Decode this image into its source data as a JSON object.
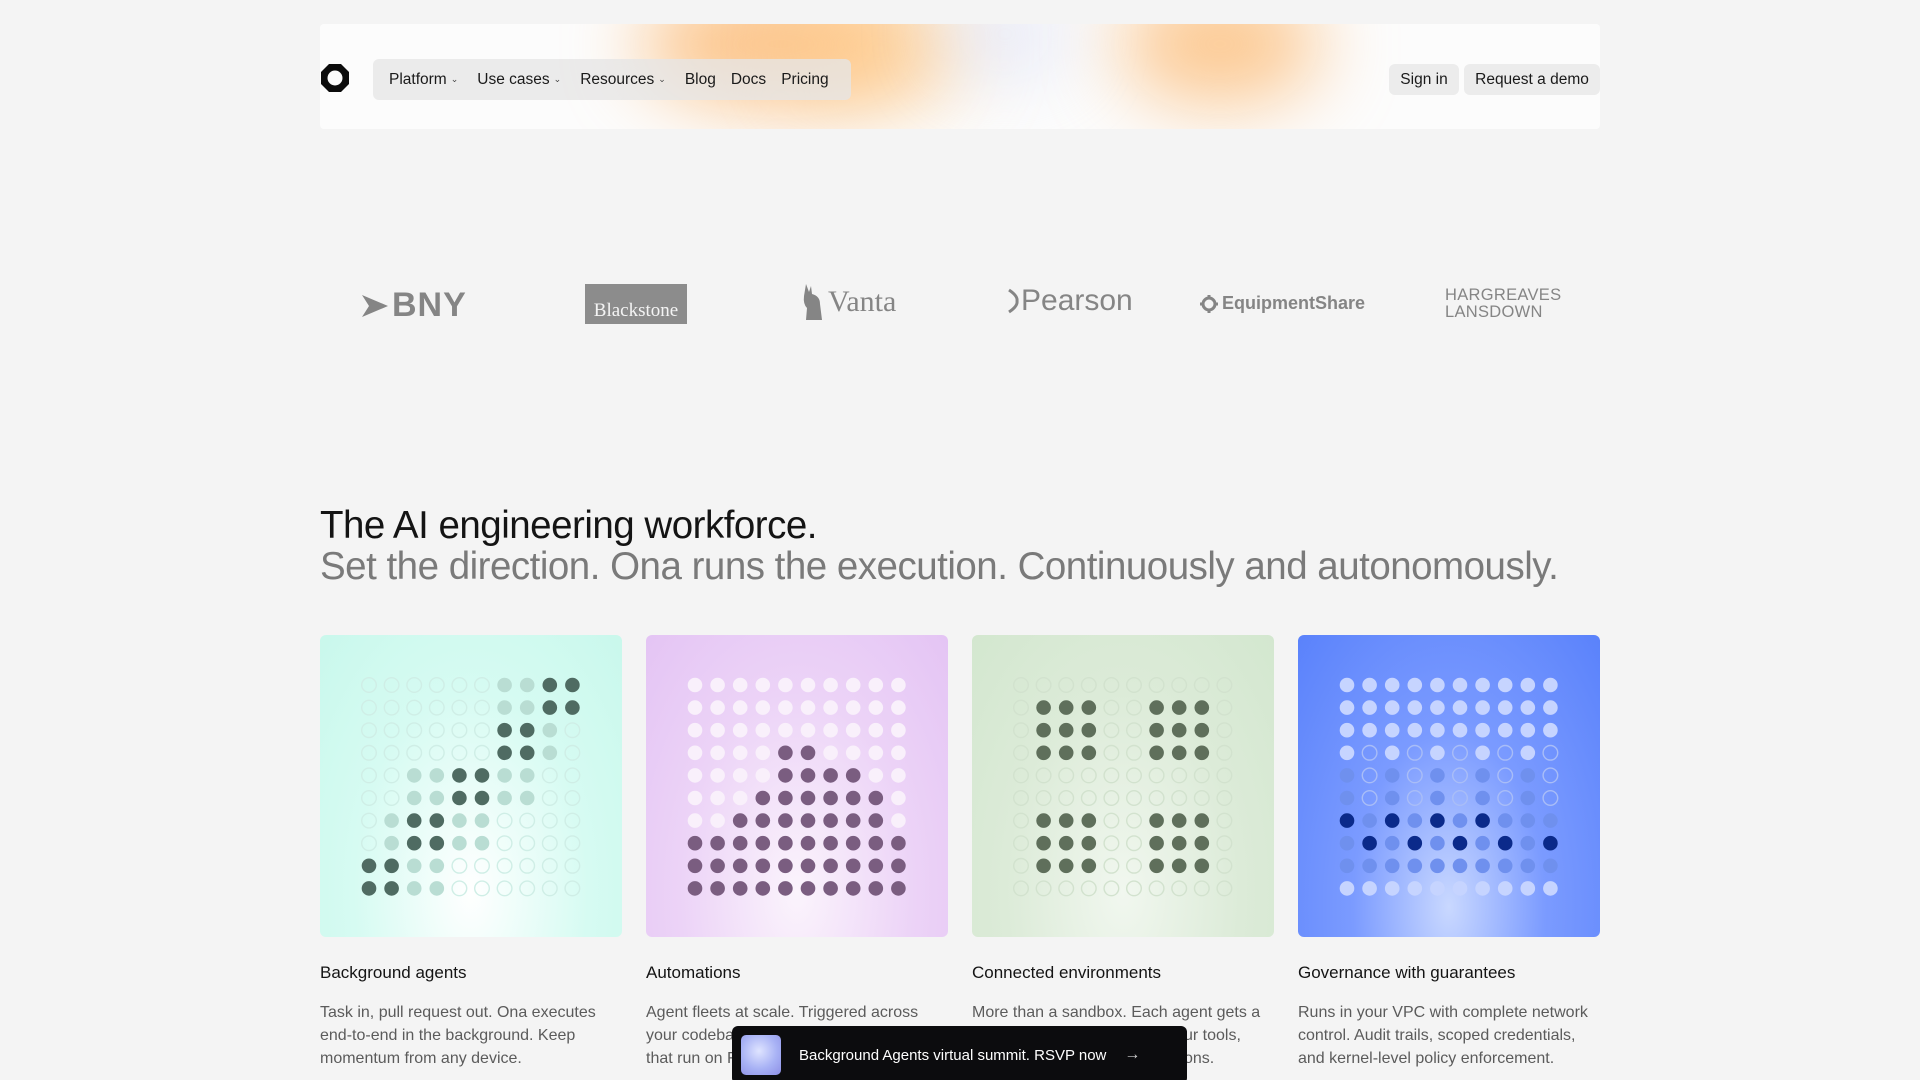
{
  "header": {
    "logo_icon": "ona-logo-icon",
    "nav": [
      {
        "label": "Platform",
        "dropdown": true
      },
      {
        "label": "Use cases",
        "dropdown": true
      },
      {
        "label": "Resources",
        "dropdown": true
      },
      {
        "label": "Blog",
        "dropdown": false
      },
      {
        "label": "Docs",
        "dropdown": false
      },
      {
        "label": "Pricing",
        "dropdown": false
      }
    ],
    "chevron": "⌄",
    "sign_in": "Sign in",
    "request_demo": "Request a demo"
  },
  "logos": {
    "bny": "BNY",
    "blackstone": "Blackstone",
    "vanta": "Vanta",
    "pearson": "Pearson",
    "equipmentshare": "EquipmentShare",
    "hargreaves_line1": "HARGREAVES",
    "hargreaves_line2": "LANSDOWN"
  },
  "hero": {
    "title": "The AI engineering workforce.",
    "subtitle": "Set the direction. Ona runs the execution. Continuously and autonomously."
  },
  "cards": [
    {
      "title": "Background agents",
      "desc": "Task in, pull request out. Ona executes end-to-end in the background. Keep momentum from any device.",
      "colors": {
        "dark": "#4f6b62",
        "mid": "#b9ddd3",
        "light": "#eafdf8",
        "ring": "#cfeee6"
      }
    },
    {
      "title": "Automations",
      "desc": "Agent fleets at scale. Triggered across your codeba... that run on F...",
      "desc_visible": [
        "Agent fleets at scale. Triggered across",
        "your codeba",
        "that run on F"
      ],
      "colors": {
        "dark": "#7a5d80",
        "mid": "#dcc4e6",
        "light": "#f9f0fb",
        "ring": "#ead8f0"
      }
    },
    {
      "title": "Connected environments",
      "desc_visible": [
        "More than a sandbox. Each agent gets a",
        "ur tools,",
        "ons."
      ],
      "colors": {
        "dark": "#5f6f5b",
        "mid": "#c8d8c4",
        "light": "#e8f2e5",
        "ring": "#d2e2ce"
      }
    },
    {
      "title": "Governance with guarantees",
      "desc": "Runs in your VPC with complete network control. Audit trails, scoped credentials, and kernel-level policy enforcement.",
      "colors": {
        "dark": "#0b2a8a",
        "mid": "#6f90ee",
        "light": "#c6d4ff",
        "ring": "#a9bdf7"
      }
    }
  ],
  "banner": {
    "text": "Background Agents virtual summit. RSVP now",
    "arrow": "→"
  }
}
